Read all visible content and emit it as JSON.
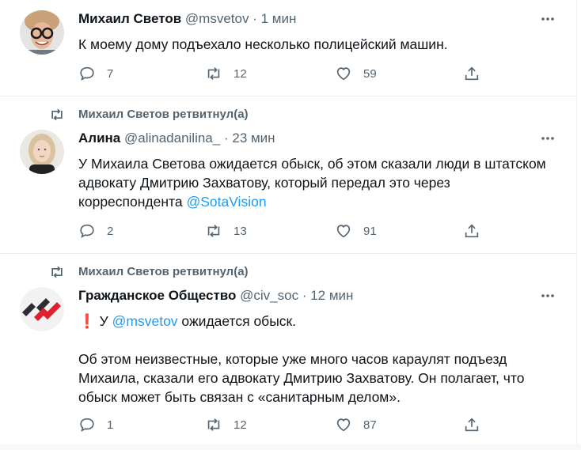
{
  "tweets": [
    {
      "name": "Михаил Светов",
      "handle": "@msvetov",
      "dot": "·",
      "time": "1 мин",
      "text": "К моему дому подъехало несколько полицейский машин.",
      "replies": "7",
      "retweets": "12",
      "likes": "59"
    },
    {
      "retweeted_by": "Михаил Светов ретвитнул(а)",
      "name": "Алина",
      "handle": "@alinadanilina_",
      "dot": "·",
      "time": "23 мин",
      "text_line1": "У Михаила Светова ожидается обыск, об этом сказали люди в штатском",
      "text_line2": "адвокату Дмитрию Захватову, который передал это через",
      "text_line3_prefix": "корреспондента ",
      "mention": "@SotaVision",
      "replies": "2",
      "retweets": "13",
      "likes": "91"
    },
    {
      "retweeted_by": "Михаил Светов ретвитнул(а)",
      "name": "Гражданское Общество",
      "handle": "@civ_soc",
      "dot": "·",
      "time": "12 мин",
      "alert_emoji": "❗",
      "text_prefix": " У ",
      "mention": "@msvetov",
      "text_suffix": " ожидается обыск.",
      "para2_line1": "Об этом неизвестные, которые уже много часов караулят подъезд",
      "para2_line2": "Михаила, сказали его адвокату Дмитрию Захватову. Он полагает, что",
      "para2_line3": "обыск может быть связан с «санитарным делом».",
      "replies": "1",
      "retweets": "12",
      "likes": "87"
    }
  ],
  "colors": {
    "accent": "#1d9bf0",
    "secondary_text": "#536471",
    "primary_text": "#0f1419",
    "logo_dark": "#2b2d33",
    "logo_red": "#e0202d"
  }
}
